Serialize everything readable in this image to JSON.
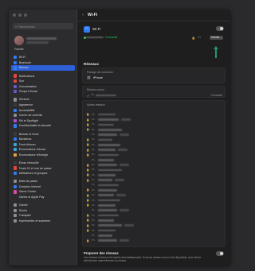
{
  "window": {
    "title": "Wi-Fi"
  },
  "sidebar": {
    "search_placeholder": "Rechercher",
    "profile": {
      "family_label": "Famille"
    },
    "items": [
      {
        "label": "Wi-Fi",
        "icon": "wifi-icon",
        "color": "#2f7cf6"
      },
      {
        "label": "Bluetooth",
        "icon": "bluetooth-icon",
        "color": "#2f7cf6"
      },
      {
        "label": "Réseau",
        "icon": "network-icon",
        "color": "#2f7cf6",
        "active": true
      },
      {
        "label": "Notifications",
        "icon": "bell-icon",
        "color": "#e5453d"
      },
      {
        "label": "Son",
        "icon": "speaker-icon",
        "color": "#e5453d"
      },
      {
        "label": "Concentration",
        "icon": "moon-icon",
        "color": "#6e56cf"
      },
      {
        "label": "Temps d'écran",
        "icon": "hourglass-icon",
        "color": "#6e56cf"
      },
      {
        "label": "Général",
        "icon": "gear-icon",
        "color": "#8e8e93"
      },
      {
        "label": "Apparence",
        "icon": "appearance-icon",
        "color": "#3a3a3c"
      },
      {
        "label": "Accessibilité",
        "icon": "accessibility-icon",
        "color": "#2f7cf6"
      },
      {
        "label": "Centre de contrôle",
        "icon": "control-center-icon",
        "color": "#8e8e93"
      },
      {
        "label": "Siri et Spotlight",
        "icon": "siri-icon",
        "color": "#b04fd8"
      },
      {
        "label": "Confidentialité et sécurité",
        "icon": "hand-icon",
        "color": "#2f7cf6"
      },
      {
        "label": "Bureau et Dock",
        "icon": "dock-icon",
        "color": "#3a3a3c"
      },
      {
        "label": "Moniteurs",
        "icon": "display-icon",
        "color": "#2f7cf6"
      },
      {
        "label": "Fond d'écran",
        "icon": "wallpaper-icon",
        "color": "#35a8e0"
      },
      {
        "label": "Économiseur d'écran",
        "icon": "screensaver-icon",
        "color": "#35a8e0"
      },
      {
        "label": "Économiseur d'énergie",
        "icon": "battery-icon",
        "color": "#e5a23d"
      },
      {
        "label": "Écran verrouillé",
        "icon": "lock-screen-icon",
        "color": "#3a3a3c"
      },
      {
        "label": "Touch ID et mot de passe",
        "icon": "fingerprint-icon",
        "color": "#e5453d"
      },
      {
        "label": "Utilisateurs et groupes",
        "icon": "users-icon",
        "color": "#2f7cf6"
      },
      {
        "label": "Mots de passe",
        "icon": "key-icon",
        "color": "#8e8e93"
      },
      {
        "label": "Comptes Internet",
        "icon": "at-icon",
        "color": "#2f7cf6"
      },
      {
        "label": "Game Center",
        "icon": "game-center-icon",
        "color": "#d84fa0"
      },
      {
        "label": "Cartes et Apple Pay",
        "icon": "wallet-icon",
        "color": "#2a2a2c"
      },
      {
        "label": "Clavier",
        "icon": "keyboard-icon",
        "color": "#8e8e93"
      },
      {
        "label": "Souris",
        "icon": "mouse-icon",
        "color": "#8e8e93"
      },
      {
        "label": "Trackpad",
        "icon": "trackpad-icon",
        "color": "#8e8e93"
      },
      {
        "label": "Imprimantes et scanners",
        "icon": "printer-icon",
        "color": "#8e8e93"
      }
    ]
  },
  "main": {
    "header": {
      "back_icon": "chevron-left-icon",
      "title": "Wi-Fi"
    },
    "wifi": {
      "label": "Wi-Fi",
      "status": "Connecté",
      "details_button": "Détails..."
    },
    "networks_title": "Réseaux",
    "hotspot": {
      "subtitle": "Partage de connexion",
      "device": "iPhone"
    },
    "known": {
      "subtitle": "Réseau connu",
      "status": "Connecté"
    },
    "other_title": "Autres réseaux",
    "other_networks_count": 26,
    "ask_join": {
      "title": "Proposer des réseaux",
      "description": "Les réseaux connus sont rejoints automatiquement. Si aucun réseau connu n'est disponible, vous devez sélectionner manuellement un réseau."
    }
  }
}
